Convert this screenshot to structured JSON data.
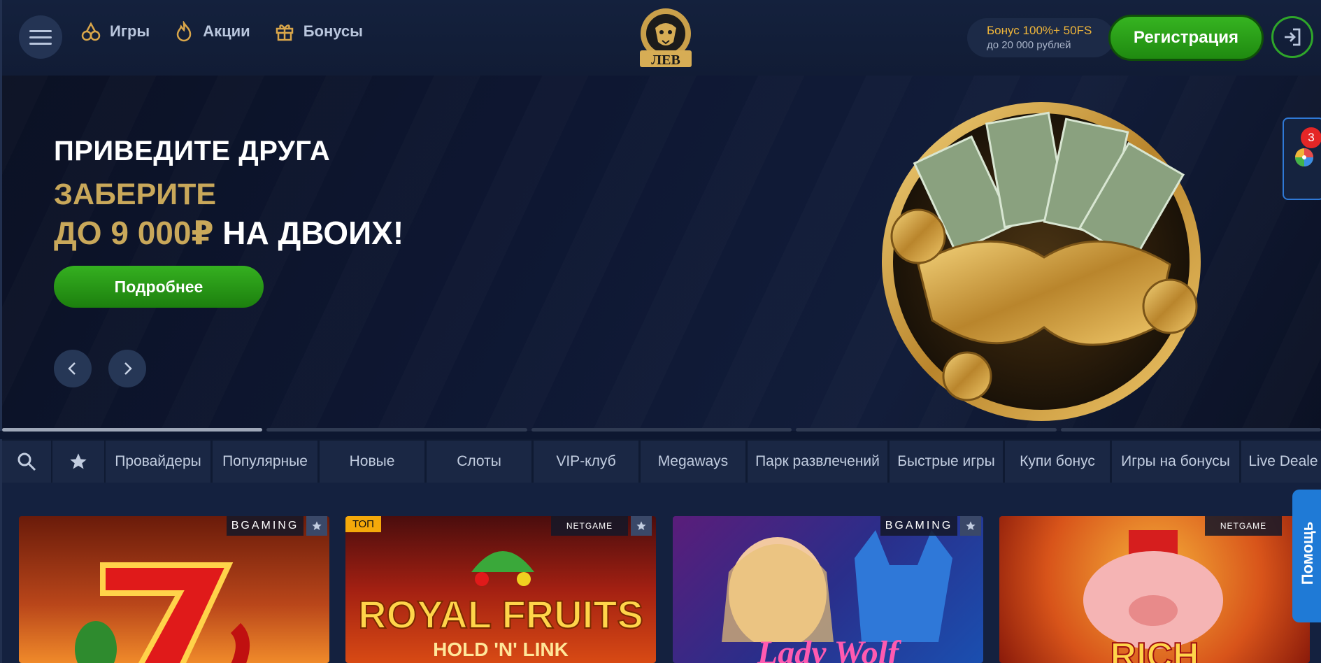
{
  "header": {
    "nav": [
      {
        "label": "Игры",
        "icon": "cherries-icon"
      },
      {
        "label": "Акции",
        "icon": "flame-icon"
      },
      {
        "label": "Бонусы",
        "icon": "gift-icon"
      }
    ],
    "logo_text": "ЛЕВ",
    "bonus_title": "Бонус 100%+ 50FS",
    "bonus_sub": "до 20 000 рублей",
    "register_label": "Регистрация"
  },
  "banner": {
    "line1": "ПРИВЕДИТЕ ДРУГА",
    "line2": "ЗАБЕРИТЕ",
    "line3_gold": "ДО 9 000₽",
    "line3_white": " НА ДВОИХ!",
    "button_label": "Подробнее",
    "slides_total": 5,
    "slide_active": 1
  },
  "side_widget": {
    "badge_count": "3",
    "icon": "wheel-of-fortune-icon"
  },
  "categories": [
    "Провайдеры",
    "Популярные",
    "Новые",
    "Слоты",
    "VIP-клуб",
    "Megaways",
    "Парк развлечений",
    "Быстрые игры",
    "Купи бонус",
    "Игры на бонусы",
    "Live Deale"
  ],
  "games": [
    {
      "provider": "BGAMING",
      "badge": "",
      "title": ""
    },
    {
      "provider": "NETGAME",
      "badge": "ТОП",
      "title": "ROYAL FRUITS",
      "subtitle": "HOLD 'N' LINK"
    },
    {
      "provider": "BGAMING",
      "badge": "",
      "title": "Lady Wolf"
    },
    {
      "provider": "NETGAME",
      "badge": "",
      "title": "RICH"
    }
  ],
  "help_label": "Помощь",
  "colors": {
    "accent_green": "#2fa62a",
    "gold": "#c9a85a",
    "bonus_yellow": "#f0b63a",
    "help_blue": "#1f7ad6"
  }
}
